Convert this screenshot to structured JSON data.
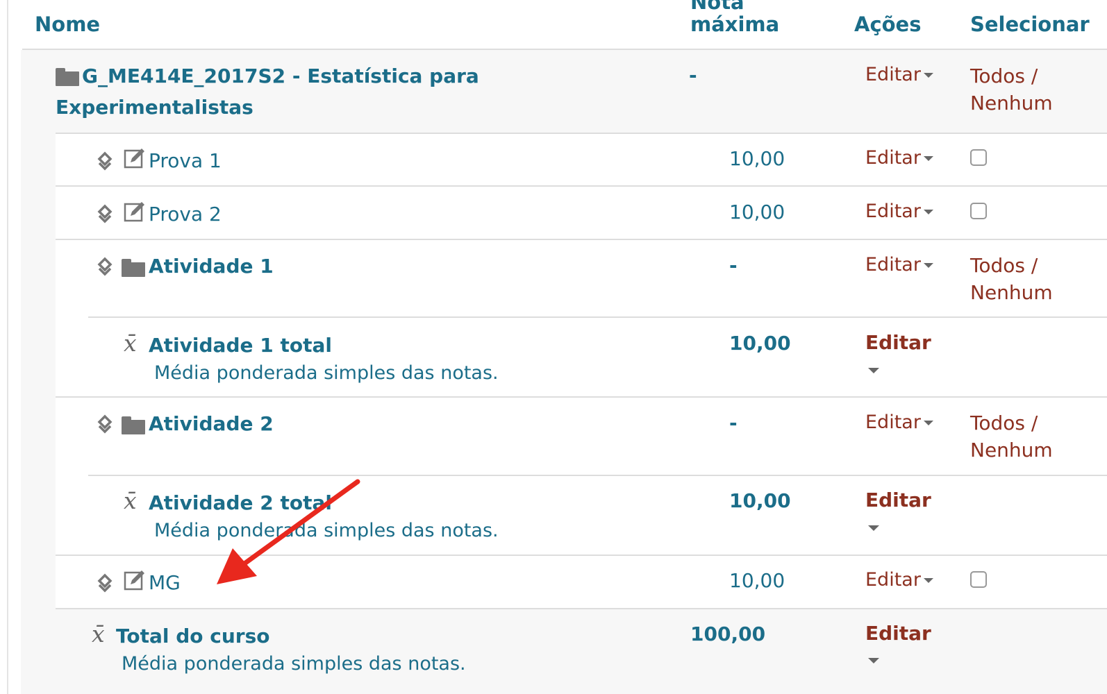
{
  "headers": {
    "name": "Nome",
    "max_grade_line1": "Nota",
    "max_grade_line2": "máxima",
    "actions": "Ações",
    "select": "Selecionar"
  },
  "edit_label": "Editar",
  "select_all": "Todos /",
  "select_none": "Nenhum",
  "course_category": {
    "name_line1": "G_ME414E_2017S2 - Estatística para",
    "name_line2": "Experimentalistas",
    "max": "-"
  },
  "rows": [
    {
      "name": "Prova 1",
      "max": "10,00"
    },
    {
      "name": "Prova 2",
      "max": "10,00"
    },
    {
      "name": "Atividade 1",
      "max": "-"
    },
    {
      "name": "Atividade 1 total",
      "desc": "Média ponderada simples das notas.",
      "max": "10,00"
    },
    {
      "name": "Atividade 2",
      "max": "-"
    },
    {
      "name": "Atividade 2 total",
      "desc": "Média ponderada simples das notas.",
      "max": "10,00"
    },
    {
      "name": "MG",
      "max": "10,00"
    },
    {
      "name": "Total do curso",
      "desc": "Média ponderada simples das notas.",
      "max": "100,00"
    }
  ],
  "icons": {
    "folder": "folder-icon",
    "move": "move-icon",
    "edit_item": "manual-item-icon",
    "mean": "mean-xbar-icon",
    "arrow": "red-arrow-annotation"
  },
  "colors": {
    "link": "#1b6d89",
    "action": "#8c3020",
    "arrow": "#e8281e",
    "row_alt": "#f7f7f7"
  }
}
